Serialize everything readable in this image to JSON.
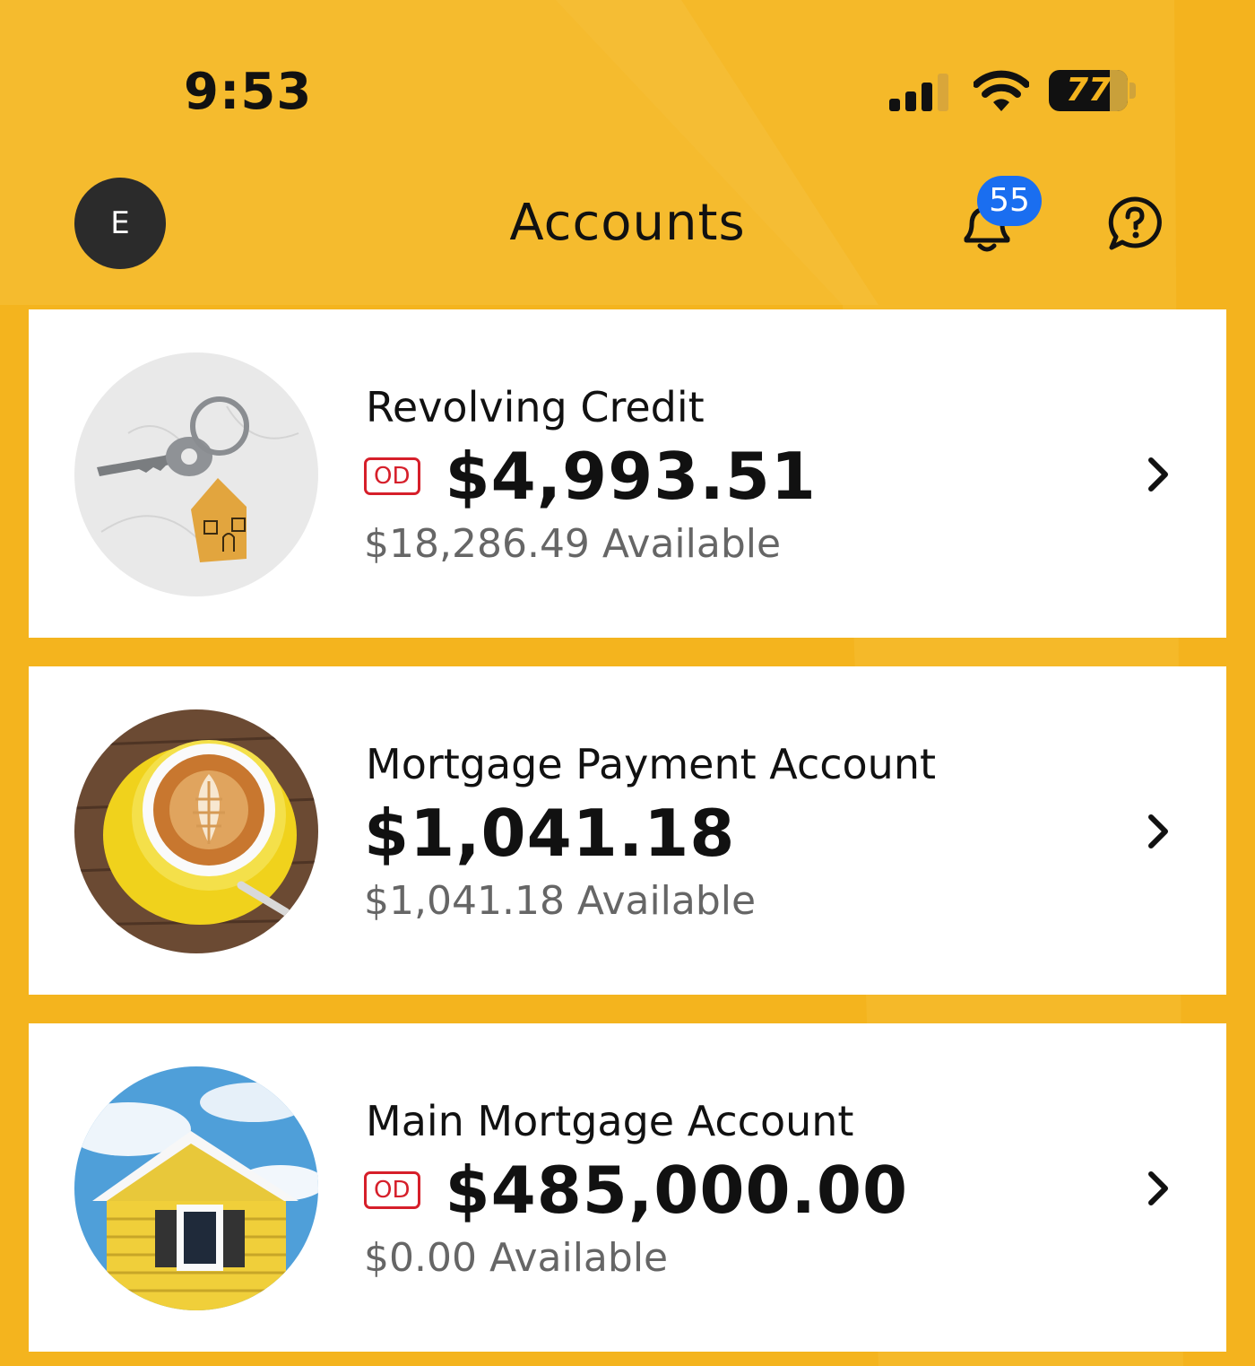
{
  "status_bar": {
    "time": "9:53",
    "battery": "77"
  },
  "header": {
    "avatar_initial": "E",
    "title": "Accounts",
    "notification_count": "55"
  },
  "accounts": [
    {
      "name": "Revolving Credit",
      "badge": "OD",
      "balance": "$4,993.51",
      "available": "$18,286.49 Available",
      "image": "house-key-icon"
    },
    {
      "name": "Mortgage Payment Account",
      "badge": "",
      "balance": "$1,041.18",
      "available": "$1,041.18 Available",
      "image": "coffee-cup-icon"
    },
    {
      "name": "Main Mortgage Account",
      "badge": "OD",
      "balance": "$485,000.00",
      "available": "$0.00 Available",
      "image": "yellow-house-icon"
    }
  ],
  "colors": {
    "background": "#f4b41e",
    "od_badge": "#d61f2a",
    "notification_badge": "#1a6ef0",
    "avatar": "#2b2b2b"
  }
}
